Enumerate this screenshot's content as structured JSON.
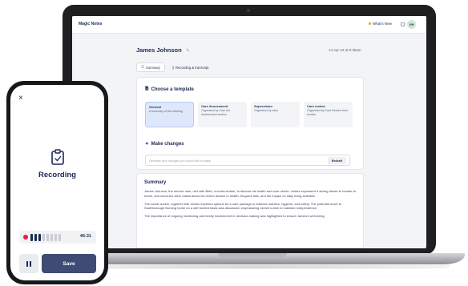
{
  "app": {
    "brand": "Magic Notes",
    "whats_new": "What's New",
    "avatar_initials": "VH"
  },
  "note": {
    "title": "James Johnson",
    "date": "14 Apr 24 at 9:35am",
    "tabs": [
      {
        "label": "Summary",
        "active": true
      },
      {
        "label": "Recording & transcript",
        "active": false
      }
    ]
  },
  "templates": {
    "heading": "Choose a template",
    "items": [
      {
        "name": "General",
        "desc": "A summary of the meeting",
        "selected": true
      },
      {
        "name": "Care Assessment",
        "desc": "Organised by Care Act Assessment section",
        "selected": false
      },
      {
        "name": "Supervision",
        "desc": "Organised by case",
        "selected": false
      },
      {
        "name": "Care review",
        "desc": "Organised by Care Review form section",
        "selected": false
      }
    ]
  },
  "changes": {
    "heading": "Make changes",
    "placeholder": "Describe any changes you would like to make",
    "button": "Redraft"
  },
  "summary": {
    "heading": "Summary",
    "paragraphs": [
      "James Johnson, the service user, met with Beth, a social worker, to discuss his health and care needs. James expressed a strong desire to remain at home, and concerns were raised about his recent decline in health, frequent falls, and the impact on daily living activities.",
      "The social worker, together with James explored options for a care package to address nutrition, hygiene, and safety. The potential move to Southborough Nursing home on a self-funded basis was discussed, emphasizing James's wish to maintain independence.",
      "The importance of ongoing monitoring and family involvement in decision-making was highlighted to ensure James's well-being."
    ]
  },
  "phone": {
    "status": "Recording",
    "timer": "46:31",
    "save_label": "Save",
    "level_bars_active": 3,
    "level_bars_total": 8
  },
  "colors": {
    "navy": "#1b2a55",
    "record_red": "#e11d48",
    "save_button": "#3f4b74",
    "selected_card": "#dfe8fb",
    "accent_dot": "#f59e0b"
  }
}
